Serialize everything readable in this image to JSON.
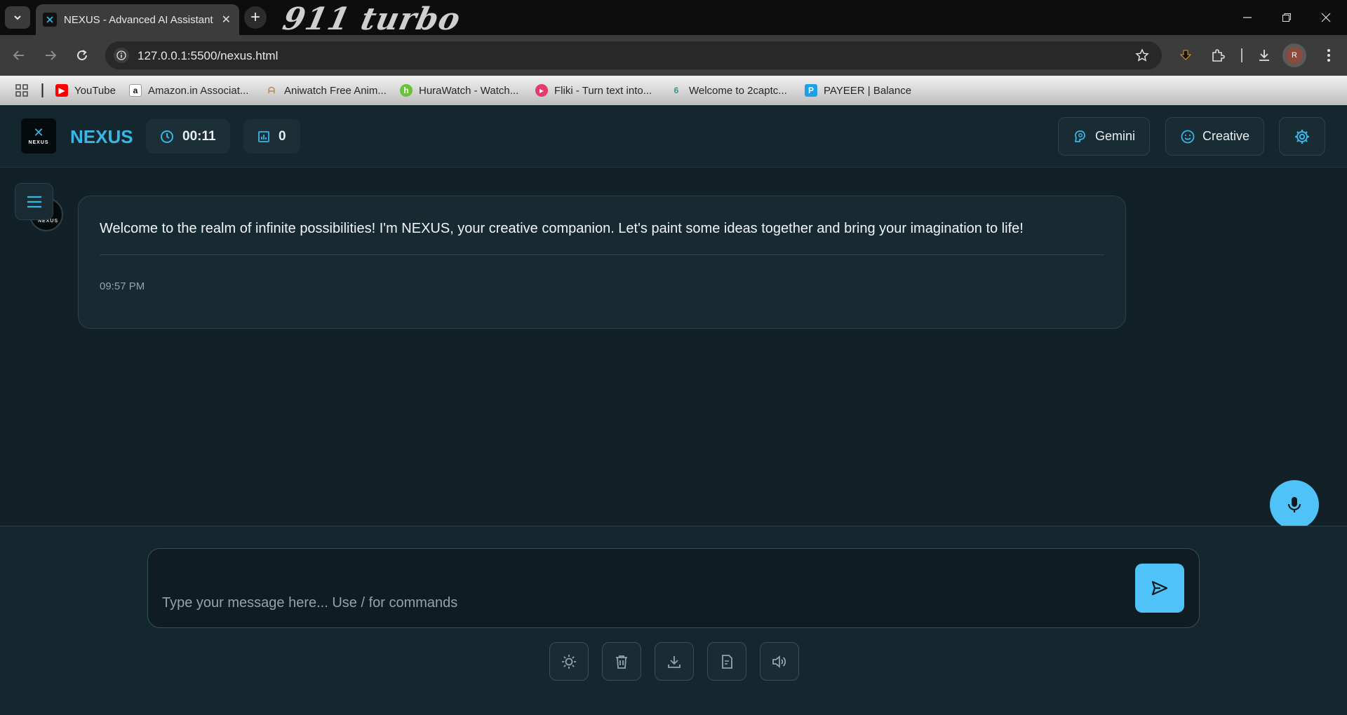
{
  "browser": {
    "tab_title": "NEXUS - Advanced AI Assistant",
    "tab_close": "✕",
    "new_tab": "+",
    "brand_script": "911 turbo",
    "url": "127.0.0.1:5500/nexus.html",
    "profile_initial": "R",
    "bookmarks": [
      {
        "label": "YouTube",
        "icon": "youtube-icon",
        "color": "#ff0000"
      },
      {
        "label": "Amazon.in Associat...",
        "icon": "amazon-icon",
        "color": "#111111"
      },
      {
        "label": "Aniwatch Free Anim...",
        "icon": "aniwatch-icon",
        "color": "#c0a080"
      },
      {
        "label": "HuraWatch - Watch...",
        "icon": "hurawatch-icon",
        "color": "#6ac13a"
      },
      {
        "label": "Fliki - Turn text into...",
        "icon": "fliki-icon",
        "color": "#e53a6a"
      },
      {
        "label": "Welcome to 2captc...",
        "icon": "2captcha-icon",
        "color": "#3b8f8c"
      },
      {
        "label": "PAYEER | Balance",
        "icon": "payeer-icon",
        "color": "#1ea0e6"
      }
    ]
  },
  "app": {
    "logo_text": "NEXUS",
    "name": "NEXUS",
    "timer": "00:11",
    "count": "0",
    "model_button": "Gemini",
    "mode_button": "Creative",
    "accent_color": "#38b6e8"
  },
  "chat": {
    "avatar_text": "NEXUS",
    "messages": [
      {
        "text": "Welcome to the realm of infinite possibilities! I'm NEXUS, your creative companion. Let's paint some ideas together and bring your imagination to life!",
        "time": "09:57 PM"
      }
    ]
  },
  "composer": {
    "placeholder": "Type your message here... Use / for commands",
    "value": ""
  }
}
